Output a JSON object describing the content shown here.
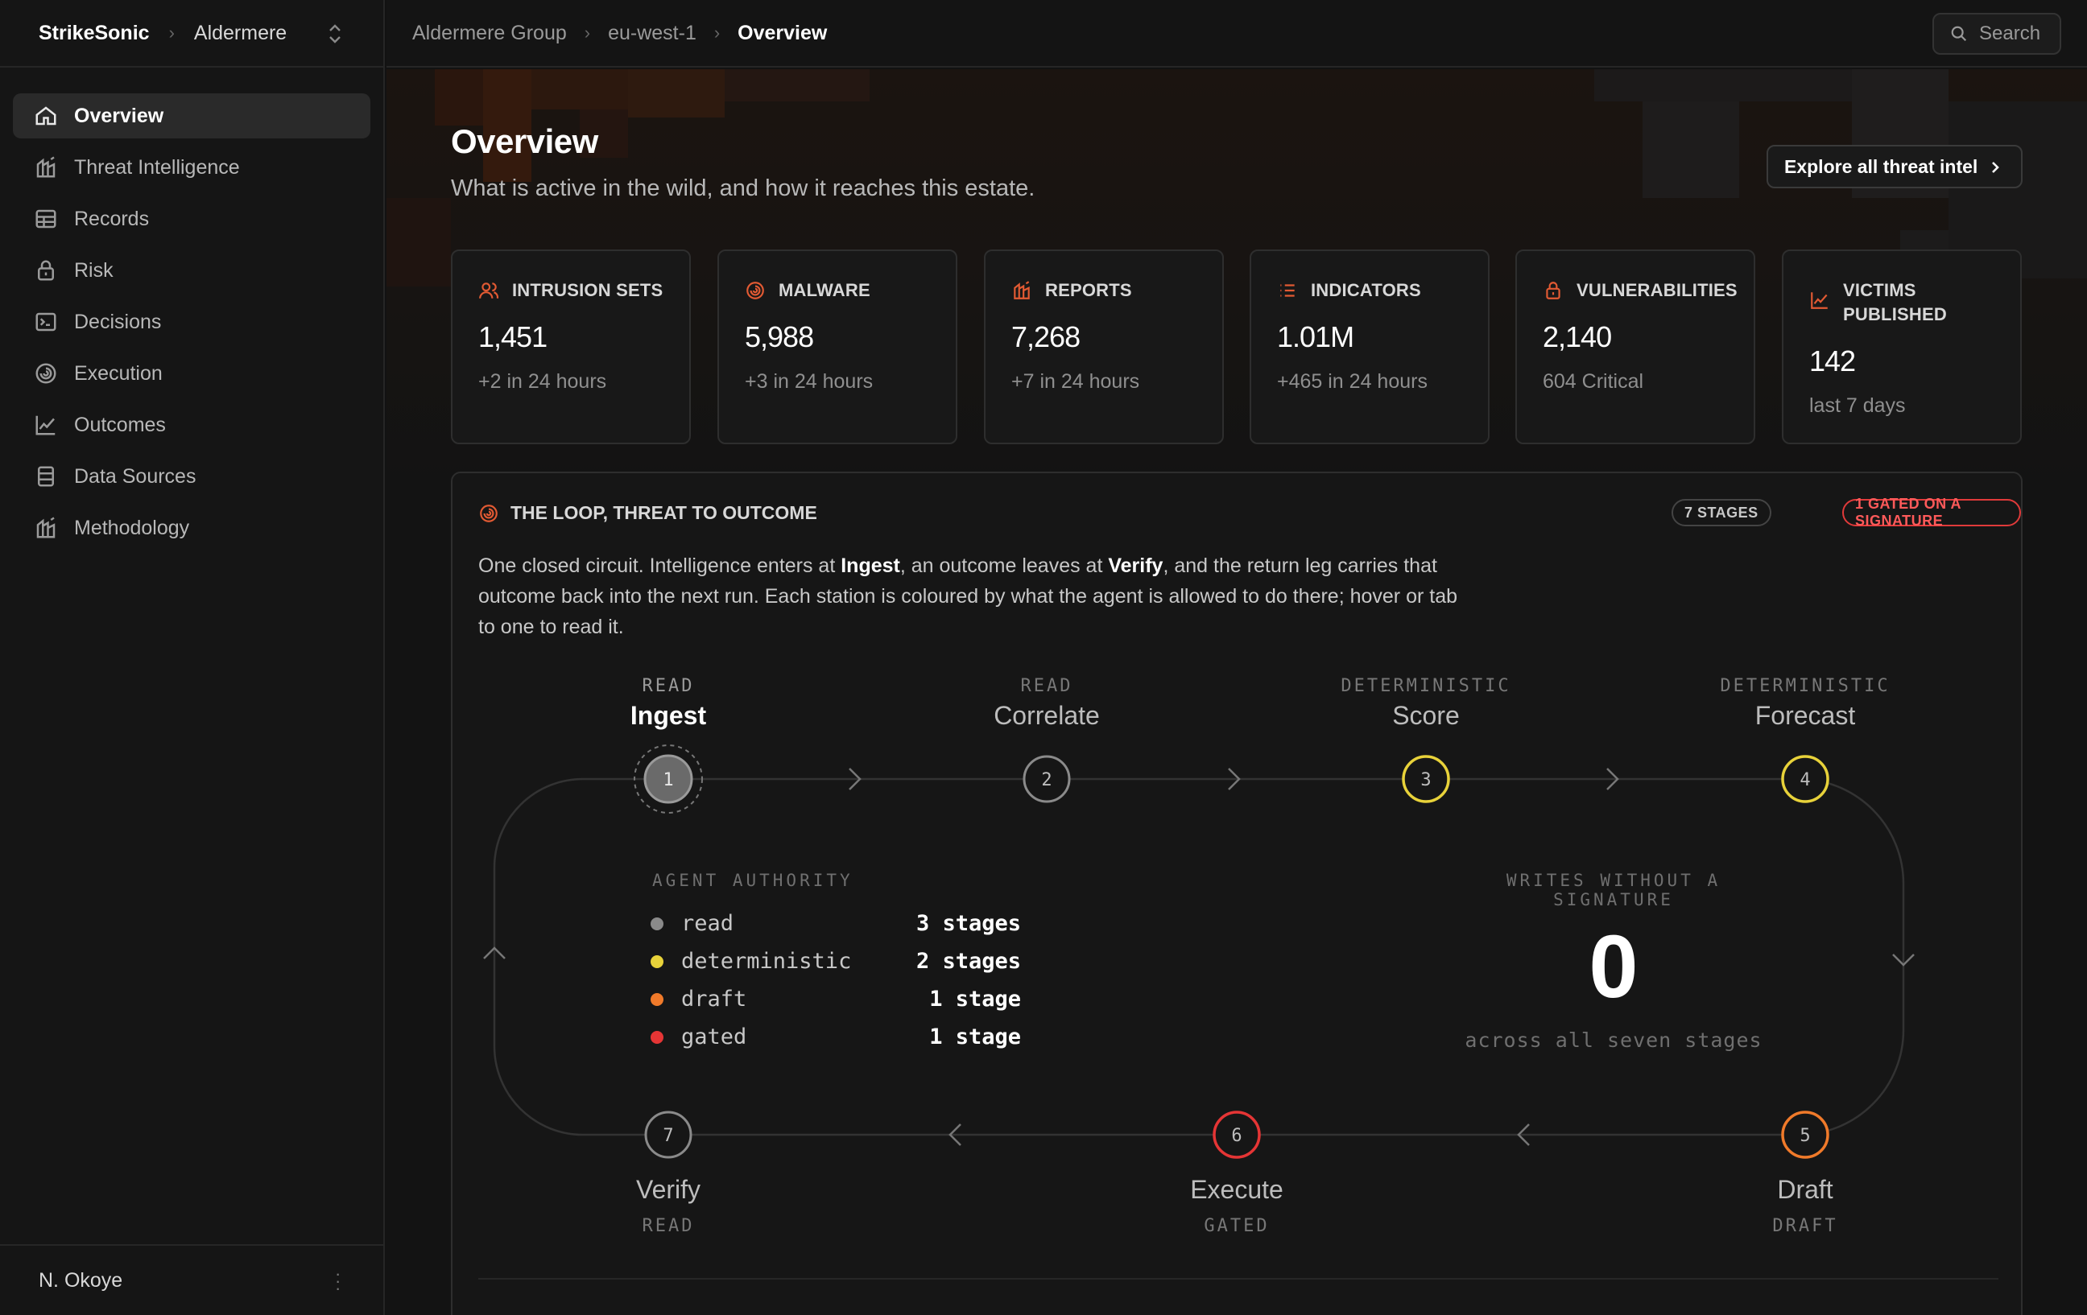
{
  "brand": {
    "product": "StrikeSonic",
    "tenant": "Aldermere"
  },
  "sidebar": {
    "items": [
      {
        "label": "Overview",
        "icon": "home-icon",
        "active": true
      },
      {
        "label": "Threat Intelligence",
        "icon": "building-chart-icon"
      },
      {
        "label": "Records",
        "icon": "table-icon"
      },
      {
        "label": "Risk",
        "icon": "lock-icon"
      },
      {
        "label": "Decisions",
        "icon": "terminal-icon"
      },
      {
        "label": "Execution",
        "icon": "spiral-icon"
      },
      {
        "label": "Outcomes",
        "icon": "line-chart-icon"
      },
      {
        "label": "Data Sources",
        "icon": "database-icon"
      },
      {
        "label": "Methodology",
        "icon": "building-chart-icon"
      }
    ],
    "user": "N. Okoye"
  },
  "topbar": {
    "breadcrumbs": [
      "Aldermere Group",
      "eu-west-1",
      "Overview"
    ],
    "search_label": "Search"
  },
  "page": {
    "title": "Overview",
    "subtitle": "What is active in the wild, and how it reaches this estate.",
    "explore_label": "Explore all threat intel"
  },
  "stats": [
    {
      "label": "INTRUSION SETS",
      "value": "1,451",
      "note": "+2 in 24 hours",
      "icon": "users-icon"
    },
    {
      "label": "MALWARE",
      "value": "5,988",
      "note": "+3 in 24 hours",
      "icon": "spiral-icon"
    },
    {
      "label": "REPORTS",
      "value": "7,268",
      "note": "+7 in 24 hours",
      "icon": "building-chart-icon"
    },
    {
      "label": "INDICATORS",
      "value": "1.01M",
      "note": "+465 in 24 hours",
      "icon": "list-icon"
    },
    {
      "label": "VULNERABILITIES",
      "value": "2,140",
      "note": "604 Critical",
      "icon": "lock-icon"
    },
    {
      "label": "VICTIMS PUBLISHED",
      "value": "142",
      "note": "last 7 days",
      "icon": "line-chart-icon"
    }
  ],
  "loop": {
    "title": "THE LOOP, THREAT TO OUTCOME",
    "stages_badge": "7 STAGES",
    "gated_badge": "1 GATED ON A SIGNATURE",
    "desc_1": "One closed circuit. Intelligence enters at ",
    "desc_ingest": "Ingest",
    "desc_2": ", an outcome leaves at ",
    "desc_verify": "Verify",
    "desc_3": ", and the return leg carries that outcome back into the next run. Each station is coloured by what the agent is allowed to do there; hover or tab to one to read it.",
    "stages": [
      {
        "num": "1",
        "name": "Ingest",
        "kind": "READ"
      },
      {
        "num": "2",
        "name": "Correlate",
        "kind": "READ"
      },
      {
        "num": "3",
        "name": "Score",
        "kind": "DETERMINISTIC"
      },
      {
        "num": "4",
        "name": "Forecast",
        "kind": "DETERMINISTIC"
      },
      {
        "num": "5",
        "name": "Draft",
        "kind": "DRAFT"
      },
      {
        "num": "6",
        "name": "Execute",
        "kind": "GATED"
      },
      {
        "num": "7",
        "name": "Verify",
        "kind": "READ"
      }
    ],
    "authority": {
      "title": "AGENT AUTHORITY",
      "rows": [
        {
          "label": "read",
          "count": "3 stages",
          "color": "#8a8a8a"
        },
        {
          "label": "deterministic",
          "count": "2 stages",
          "color": "#e8d23a"
        },
        {
          "label": "draft",
          "count": "1 stage",
          "color": "#f07a2a"
        },
        {
          "label": "gated",
          "count": "1 stage",
          "color": "#e53535"
        }
      ]
    },
    "writes": {
      "title": "WRITES WITHOUT A SIGNATURE",
      "value": "0",
      "note": "across all seven stages"
    }
  },
  "colors": {
    "accent": "#e25a33",
    "read": "#8a8a8a",
    "deterministic": "#e8d23a",
    "draft": "#f07a2a",
    "gated": "#e53535"
  }
}
